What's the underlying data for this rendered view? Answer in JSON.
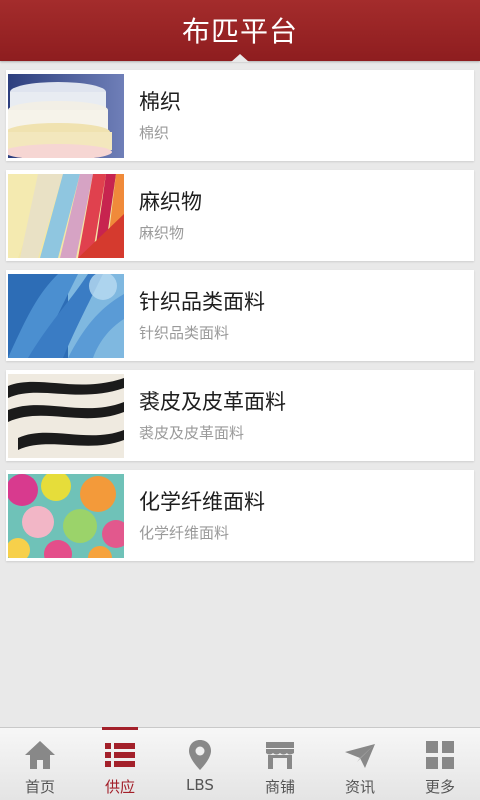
{
  "header": {
    "title": "布匹平台"
  },
  "colors": {
    "brand": "#a3202a",
    "icon_gray": "#888888"
  },
  "items": [
    {
      "name": "棉织",
      "sub": "棉织"
    },
    {
      "name": "麻织物",
      "sub": "麻织物"
    },
    {
      "name": "针织品类面料",
      "sub": "针织品类面料"
    },
    {
      "name": "裘皮及皮革面料",
      "sub": "裘皮及皮革面料"
    },
    {
      "name": "化学纤维面料",
      "sub": "化学纤维面料"
    }
  ],
  "tabs": [
    {
      "label": "首页",
      "icon": "home-icon",
      "active": false
    },
    {
      "label": "供应",
      "icon": "list-icon",
      "active": true
    },
    {
      "label": "LBS",
      "icon": "location-pin-icon",
      "active": false
    },
    {
      "label": "商铺",
      "icon": "shop-icon",
      "active": false
    },
    {
      "label": "资讯",
      "icon": "news-plane-icon",
      "active": false
    },
    {
      "label": "更多",
      "icon": "grid-icon",
      "active": false
    }
  ]
}
